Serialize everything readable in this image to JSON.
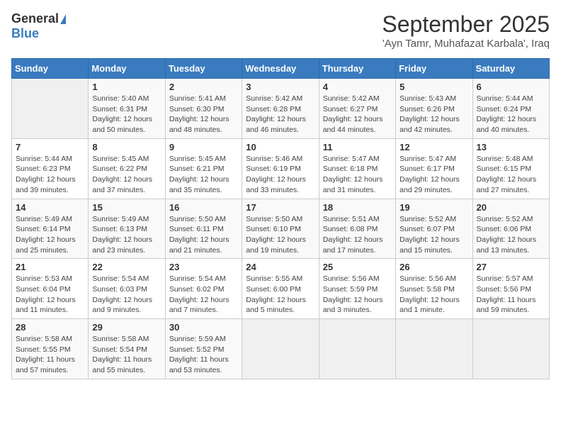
{
  "header": {
    "logo_general": "General",
    "logo_blue": "Blue",
    "title": "September 2025",
    "location": "'Ayn Tamr, Muhafazat Karbala', Iraq"
  },
  "weekdays": [
    "Sunday",
    "Monday",
    "Tuesday",
    "Wednesday",
    "Thursday",
    "Friday",
    "Saturday"
  ],
  "weeks": [
    [
      {
        "day": "",
        "sunrise": "",
        "sunset": "",
        "daylight": ""
      },
      {
        "day": "1",
        "sunrise": "Sunrise: 5:40 AM",
        "sunset": "Sunset: 6:31 PM",
        "daylight": "Daylight: 12 hours and 50 minutes."
      },
      {
        "day": "2",
        "sunrise": "Sunrise: 5:41 AM",
        "sunset": "Sunset: 6:30 PM",
        "daylight": "Daylight: 12 hours and 48 minutes."
      },
      {
        "day": "3",
        "sunrise": "Sunrise: 5:42 AM",
        "sunset": "Sunset: 6:28 PM",
        "daylight": "Daylight: 12 hours and 46 minutes."
      },
      {
        "day": "4",
        "sunrise": "Sunrise: 5:42 AM",
        "sunset": "Sunset: 6:27 PM",
        "daylight": "Daylight: 12 hours and 44 minutes."
      },
      {
        "day": "5",
        "sunrise": "Sunrise: 5:43 AM",
        "sunset": "Sunset: 6:26 PM",
        "daylight": "Daylight: 12 hours and 42 minutes."
      },
      {
        "day": "6",
        "sunrise": "Sunrise: 5:44 AM",
        "sunset": "Sunset: 6:24 PM",
        "daylight": "Daylight: 12 hours and 40 minutes."
      }
    ],
    [
      {
        "day": "7",
        "sunrise": "Sunrise: 5:44 AM",
        "sunset": "Sunset: 6:23 PM",
        "daylight": "Daylight: 12 hours and 39 minutes."
      },
      {
        "day": "8",
        "sunrise": "Sunrise: 5:45 AM",
        "sunset": "Sunset: 6:22 PM",
        "daylight": "Daylight: 12 hours and 37 minutes."
      },
      {
        "day": "9",
        "sunrise": "Sunrise: 5:45 AM",
        "sunset": "Sunset: 6:21 PM",
        "daylight": "Daylight: 12 hours and 35 minutes."
      },
      {
        "day": "10",
        "sunrise": "Sunrise: 5:46 AM",
        "sunset": "Sunset: 6:19 PM",
        "daylight": "Daylight: 12 hours and 33 minutes."
      },
      {
        "day": "11",
        "sunrise": "Sunrise: 5:47 AM",
        "sunset": "Sunset: 6:18 PM",
        "daylight": "Daylight: 12 hours and 31 minutes."
      },
      {
        "day": "12",
        "sunrise": "Sunrise: 5:47 AM",
        "sunset": "Sunset: 6:17 PM",
        "daylight": "Daylight: 12 hours and 29 minutes."
      },
      {
        "day": "13",
        "sunrise": "Sunrise: 5:48 AM",
        "sunset": "Sunset: 6:15 PM",
        "daylight": "Daylight: 12 hours and 27 minutes."
      }
    ],
    [
      {
        "day": "14",
        "sunrise": "Sunrise: 5:49 AM",
        "sunset": "Sunset: 6:14 PM",
        "daylight": "Daylight: 12 hours and 25 minutes."
      },
      {
        "day": "15",
        "sunrise": "Sunrise: 5:49 AM",
        "sunset": "Sunset: 6:13 PM",
        "daylight": "Daylight: 12 hours and 23 minutes."
      },
      {
        "day": "16",
        "sunrise": "Sunrise: 5:50 AM",
        "sunset": "Sunset: 6:11 PM",
        "daylight": "Daylight: 12 hours and 21 minutes."
      },
      {
        "day": "17",
        "sunrise": "Sunrise: 5:50 AM",
        "sunset": "Sunset: 6:10 PM",
        "daylight": "Daylight: 12 hours and 19 minutes."
      },
      {
        "day": "18",
        "sunrise": "Sunrise: 5:51 AM",
        "sunset": "Sunset: 6:08 PM",
        "daylight": "Daylight: 12 hours and 17 minutes."
      },
      {
        "day": "19",
        "sunrise": "Sunrise: 5:52 AM",
        "sunset": "Sunset: 6:07 PM",
        "daylight": "Daylight: 12 hours and 15 minutes."
      },
      {
        "day": "20",
        "sunrise": "Sunrise: 5:52 AM",
        "sunset": "Sunset: 6:06 PM",
        "daylight": "Daylight: 12 hours and 13 minutes."
      }
    ],
    [
      {
        "day": "21",
        "sunrise": "Sunrise: 5:53 AM",
        "sunset": "Sunset: 6:04 PM",
        "daylight": "Daylight: 12 hours and 11 minutes."
      },
      {
        "day": "22",
        "sunrise": "Sunrise: 5:54 AM",
        "sunset": "Sunset: 6:03 PM",
        "daylight": "Daylight: 12 hours and 9 minutes."
      },
      {
        "day": "23",
        "sunrise": "Sunrise: 5:54 AM",
        "sunset": "Sunset: 6:02 PM",
        "daylight": "Daylight: 12 hours and 7 minutes."
      },
      {
        "day": "24",
        "sunrise": "Sunrise: 5:55 AM",
        "sunset": "Sunset: 6:00 PM",
        "daylight": "Daylight: 12 hours and 5 minutes."
      },
      {
        "day": "25",
        "sunrise": "Sunrise: 5:56 AM",
        "sunset": "Sunset: 5:59 PM",
        "daylight": "Daylight: 12 hours and 3 minutes."
      },
      {
        "day": "26",
        "sunrise": "Sunrise: 5:56 AM",
        "sunset": "Sunset: 5:58 PM",
        "daylight": "Daylight: 12 hours and 1 minute."
      },
      {
        "day": "27",
        "sunrise": "Sunrise: 5:57 AM",
        "sunset": "Sunset: 5:56 PM",
        "daylight": "Daylight: 11 hours and 59 minutes."
      }
    ],
    [
      {
        "day": "28",
        "sunrise": "Sunrise: 5:58 AM",
        "sunset": "Sunset: 5:55 PM",
        "daylight": "Daylight: 11 hours and 57 minutes."
      },
      {
        "day": "29",
        "sunrise": "Sunrise: 5:58 AM",
        "sunset": "Sunset: 5:54 PM",
        "daylight": "Daylight: 11 hours and 55 minutes."
      },
      {
        "day": "30",
        "sunrise": "Sunrise: 5:59 AM",
        "sunset": "Sunset: 5:52 PM",
        "daylight": "Daylight: 11 hours and 53 minutes."
      },
      {
        "day": "",
        "sunrise": "",
        "sunset": "",
        "daylight": ""
      },
      {
        "day": "",
        "sunrise": "",
        "sunset": "",
        "daylight": ""
      },
      {
        "day": "",
        "sunrise": "",
        "sunset": "",
        "daylight": ""
      },
      {
        "day": "",
        "sunrise": "",
        "sunset": "",
        "daylight": ""
      }
    ]
  ]
}
